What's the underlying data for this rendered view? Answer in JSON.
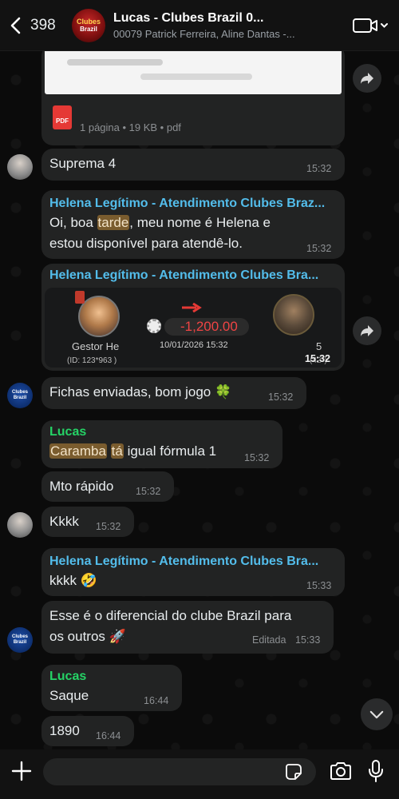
{
  "header": {
    "back_count": "398",
    "group_avatar_line1": "Clubes",
    "group_avatar_line2": "Brazil",
    "title": "Lucas              - Clubes Brazil 0...",
    "subtitle": "00079 Patrick Ferreira, Aline Dantas -..."
  },
  "messages": {
    "doc": {
      "meta": "1 página • 19 KB • pdf",
      "icon_label": "PDF"
    },
    "m1": {
      "text": "Suprema 4",
      "time": "15:32"
    },
    "m2": {
      "sender": "Helena Legítimo - Atendimento Clubes Braz...",
      "line1_hl": "tarde",
      "line1_a": "Oi, boa ",
      "line1_b": ", meu nome é Helena e",
      "line2": "estou disponível para atendê-lo.",
      "time": "15:32"
    },
    "m3": {
      "sender": "Helena Legítimo - Atendimento Clubes Bra...",
      "player_name": "Gestor He",
      "player_id": "(ID: 123*963 )",
      "amount": "-1,200.00",
      "date": "10/01/2026 15:32",
      "right_num": "5",
      "right_sub": "(42*)",
      "time": "15:32"
    },
    "m4": {
      "text": "Fichas enviadas, bom jogo 🍀",
      "time": "15:32"
    },
    "m5": {
      "sender": "Lucas",
      "hl1": "Caramba",
      "hl2": "tá",
      "rest": " igual fórmula 1",
      "time": "15:32"
    },
    "m6": {
      "text": "Mto rápido",
      "time": "15:32"
    },
    "m7": {
      "text": "Kkkk",
      "time": "15:32"
    },
    "m8": {
      "sender": "Helena Legítimo - Atendimento Clubes Bra...",
      "text": "kkkk 🤣",
      "time": "15:33"
    },
    "m9": {
      "line1": "Esse é o diferencial do clube Brazil para",
      "line2": "os outros 🚀",
      "edited": "Editada",
      "time": "15:33"
    },
    "m10": {
      "sender": "Lucas",
      "text": "Saque",
      "time": "16:44"
    },
    "m11": {
      "text": "1890",
      "time": "16:44"
    }
  },
  "composer": {
    "placeholder": ""
  },
  "colors": {
    "bubble": "#222323",
    "sender_blue": "#53bdeb",
    "sender_green": "#25d366",
    "highlight": "#7a5c2e"
  }
}
